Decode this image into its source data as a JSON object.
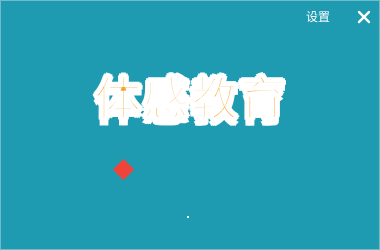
{
  "header": {
    "settings_label": "设置",
    "close_icon": "close-icon"
  },
  "main": {
    "title": "体感教育"
  },
  "colors": {
    "background": "#1e9bb0",
    "title_fill": "#f6a52c",
    "title_outline": "#ffffff",
    "diamond": "#f0443a"
  }
}
